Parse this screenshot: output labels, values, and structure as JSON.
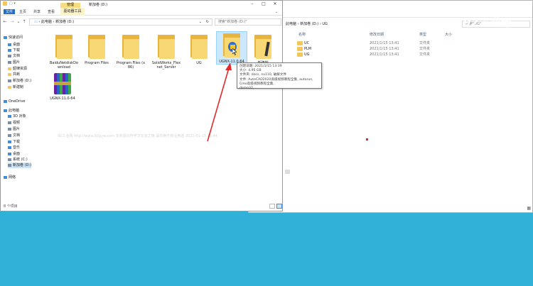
{
  "back_window": {
    "breadcrumb": [
      "此电脑",
      "新加卷 (D:)",
      "UG"
    ],
    "search_placeholder": "搜索\"UG\"",
    "headers": {
      "name": "名称",
      "modified": "修改日期",
      "type": "类型",
      "size": "大小"
    },
    "rows": [
      {
        "name": "UC",
        "modified": "2021/1/15 13:41",
        "type": "文件夹"
      },
      {
        "name": "PLM",
        "modified": "2021/1/15 13:41",
        "type": "文件夹"
      },
      {
        "name": "UG",
        "modified": "2021/1/15 13:41",
        "type": "文件夹"
      }
    ]
  },
  "logo": {
    "text": "92工业网",
    "url_text": "WWW.92GYW.COM"
  },
  "front_window": {
    "title": "新加卷 (D:)",
    "context_tab": "管理",
    "context_sub": "驱动器工具",
    "menus": [
      "文件",
      "主页",
      "共享",
      "查看"
    ],
    "breadcrumb": [
      "此电脑",
      "新加卷 (D:)"
    ],
    "search_placeholder": "搜索\"新加卷 (D:)\"",
    "sidebar": [
      {
        "label": "快速访问",
        "icon": "star-icon",
        "color": "#3b8ee6"
      },
      {
        "label": "桌面",
        "icon": "desktop-icon",
        "color": "#3b8ee6"
      },
      {
        "label": "下载",
        "icon": "download-icon",
        "color": "#3b8ee6"
      },
      {
        "label": "文档",
        "icon": "document-icon",
        "color": "#7a8ca6"
      },
      {
        "label": "图片",
        "icon": "picture-icon",
        "color": "#7a8ca6"
      },
      {
        "label": "韶律资源",
        "icon": "folder-icon",
        "color": "#f3c85a"
      },
      {
        "label": "共耗",
        "icon": "folder-icon",
        "color": "#f3c85a"
      },
      {
        "label": "新加卷 (D:)",
        "icon": "drive-icon",
        "color": "#7a8ca6"
      },
      {
        "label": "新建制",
        "icon": "folder-icon",
        "color": "#f3c85a"
      },
      {
        "label": "OneDrive",
        "icon": "cloud-icon",
        "color": "#3b8ee6"
      },
      {
        "label": "此电脑",
        "icon": "computer-icon",
        "color": "#3b8ee6"
      },
      {
        "label": "3D 对象",
        "icon": "cube-icon",
        "color": "#3b8ee6"
      },
      {
        "label": "视频",
        "icon": "video-icon",
        "color": "#7a8ca6"
      },
      {
        "label": "图片",
        "icon": "picture-icon",
        "color": "#7a8ca6"
      },
      {
        "label": "文档",
        "icon": "document-icon",
        "color": "#7a8ca6"
      },
      {
        "label": "下载",
        "icon": "download-icon",
        "color": "#3b8ee6"
      },
      {
        "label": "音乐",
        "icon": "music-icon",
        "color": "#3b8ee6"
      },
      {
        "label": "桌面",
        "icon": "desktop-icon",
        "color": "#3b8ee6"
      },
      {
        "label": "系统 (C:)",
        "icon": "drive-icon",
        "color": "#7a8ca6"
      },
      {
        "label": "新加卷 (D:)",
        "icon": "drive-icon",
        "color": "#7a8ca6"
      },
      {
        "label": "网络",
        "icon": "network-icon",
        "color": "#3b8ee6"
      }
    ],
    "items": [
      {
        "label": "BaiduNetdiskDownload",
        "kind": "folder"
      },
      {
        "label": "Program Files",
        "kind": "folder"
      },
      {
        "label": "Program Files (x86)",
        "kind": "folder"
      },
      {
        "label": "SolidWorks_Flexnet_Server",
        "kind": "folder"
      },
      {
        "label": "UG",
        "kind": "folder"
      },
      {
        "label": "UGNX-11.0-64",
        "kind": "folder-selected"
      },
      {
        "label": "新建制",
        "kind": "folder"
      },
      {
        "label": "UGNX-11.0-64",
        "kind": "rar"
      }
    ],
    "tooltip": [
      "创建日期: 2021/1/15 13:39",
      "大小: 4.95 GB",
      "文件夹: docs, nx110, 破解文件",
      "文件: AutoCAD2020高级视频教程全集, autorun, Creo高级视频教程全集,",
      "demo32, ..."
    ],
    "status": "8 个项目",
    "watermark": "92工业网 http://www.92gyw.com 本资源仅作学习交流之用 请勿用于商业用途 2021-01-15 13:44"
  }
}
